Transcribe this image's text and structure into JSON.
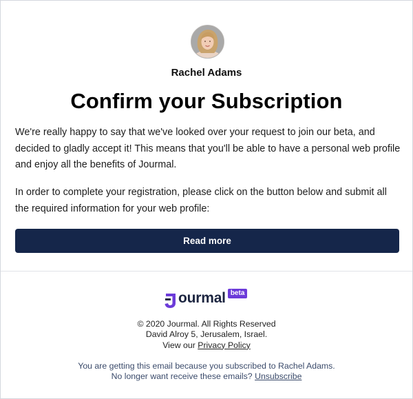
{
  "sender": {
    "name": "Rachel Adams"
  },
  "email": {
    "title": "Confirm your Subscription",
    "paragraph_1": "We're really happy to say that we've looked over your request to join our beta, and decided to gladly accept it! This means that you'll be able to have a personal web profile and enjoy all the benefits of Jourmal.",
    "paragraph_2": "In order to complete your registration, please click on the button below and submit all the required information for your web profile:",
    "cta_label": "Read more"
  },
  "footer": {
    "logo_text": "ourmal",
    "beta_badge": "beta",
    "copyright": "© 2020 Jourmal. All Rights Reserved",
    "address": "David Alroy 5, Jerusalem, Israel.",
    "privacy_prefix": "View our ",
    "privacy_link": "Privacy Policy",
    "notice_line_1": "You are getting this email because you subscribed to Rachel Adams.",
    "notice_prefix": "No longer want receive these emails? ",
    "unsubscribe_link": "Unsubscribe"
  },
  "colors": {
    "cta_background": "#15264a",
    "brand_purple": "#6c3bd9",
    "brand_dark": "#1c2540"
  },
  "icons": {
    "avatar": "profile-photo",
    "logo_mark": "jourmal-j-logo"
  }
}
